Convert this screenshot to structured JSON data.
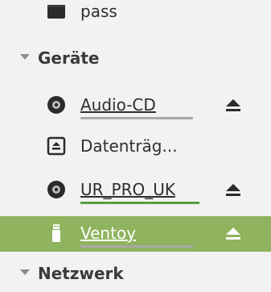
{
  "sidebar": {
    "items": [
      {
        "kind": "bookmark",
        "label": "pass",
        "icon": "folder-icon"
      },
      {
        "kind": "header",
        "label": "Geräte",
        "icon": "chevron-down-icon"
      },
      {
        "kind": "device",
        "label": "Audio-CD",
        "icon": "optical-disc-icon",
        "ejectable": true,
        "usage_fraction": 0.0
      },
      {
        "kind": "device",
        "label": "Datenträg...",
        "icon": "drive-icon",
        "ejectable": false
      },
      {
        "kind": "device",
        "label": "UR_PRO_UK",
        "icon": "optical-disc-icon",
        "ejectable": true,
        "usage_fraction": 1.0
      },
      {
        "kind": "device",
        "label": "Ventoy",
        "icon": "usb-stick-icon",
        "ejectable": true,
        "selected": true,
        "usage_fraction": 0.0
      },
      {
        "kind": "header",
        "label": "Netzwerk",
        "icon": "chevron-down-icon"
      }
    ]
  },
  "colors": {
    "background": "#f2f2f2",
    "selection": "#8fb35e",
    "usage_track": "#a8a8a8",
    "usage_fill": "#5a9e3a",
    "text": "#2e2e2e"
  }
}
